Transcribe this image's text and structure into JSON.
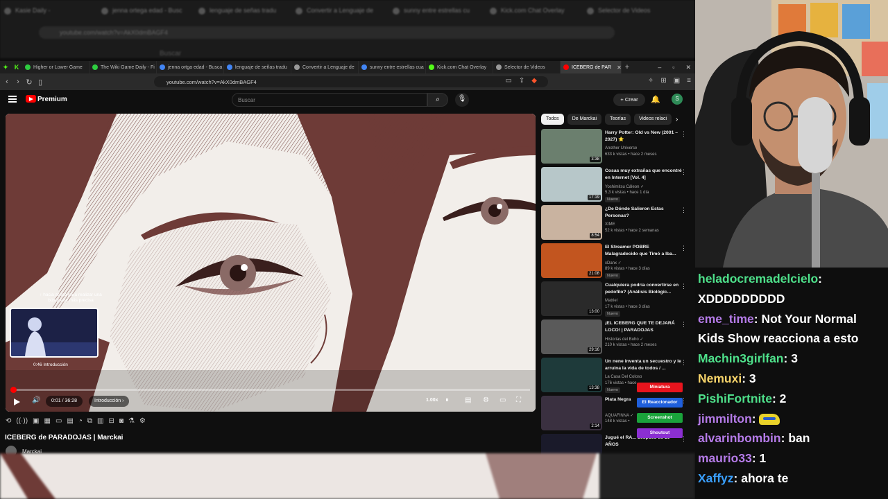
{
  "background": {
    "tabs": [
      "Kasie Daily -",
      "jenna ortega edad - Busc",
      "lenguaje de señas tradu",
      "Convertir a Lenguaje de",
      "sunny entre estrellas cu",
      "Kick.com Chat Overlay",
      "Selector de Videos",
      "ICEBERG de PA"
    ],
    "address": "youtube.com/watch?v=AkX0dmBAGF4",
    "search_hint": "Buscar"
  },
  "browser": {
    "tabs": [
      {
        "label": "Higher or Lower Game",
        "color": "#2ecc40",
        "active": false
      },
      {
        "label": "The Wiki Game Daily - Fi",
        "color": "#2ecc40",
        "active": false
      },
      {
        "label": "jenna ortga edad - Busca",
        "color": "#4285f4",
        "active": false
      },
      {
        "label": "lenguaje de señas tradu",
        "color": "#4285f4",
        "active": false
      },
      {
        "label": "Convertir a Lenguaje de",
        "color": "#999999",
        "active": false
      },
      {
        "label": "sunny entre estrellas cua",
        "color": "#4285f4",
        "active": false
      },
      {
        "label": "Kick.com Chat Overlay",
        "color": "#53fc18",
        "active": false
      },
      {
        "label": "Selector de Videos",
        "color": "#999999",
        "active": false
      },
      {
        "label": "ICEBERG de PAR",
        "color": "#ff0000",
        "active": true
      }
    ],
    "url": "youtube.com/watch?v=AkX0dmBAGF4"
  },
  "youtube": {
    "brand": "Premium",
    "search_placeholder": "Buscar",
    "create_label": "+ Crear",
    "avatar_letter": "S"
  },
  "player": {
    "preview_hint": "↑ hacia arriba para realizar una búsqueda más precisa",
    "preview_time": "0:46  Introducción",
    "current_time": "0:01 / 36:28",
    "chapter": "Introducción ›",
    "speed": "1.00x",
    "progress_fraction": 0.0005
  },
  "video": {
    "title": "ICEBERG de PARADOJAS | Marckai",
    "channel": "Marckai"
  },
  "sidebar": {
    "chips": [
      {
        "label": "Todos",
        "active": true
      },
      {
        "label": "De Marckai",
        "active": false
      },
      {
        "label": "Teorías",
        "active": false
      },
      {
        "label": "Videos relaci",
        "active": false
      }
    ],
    "recs": [
      {
        "title": "Harry Potter: Old vs New (2001 – 2027) ⭐",
        "channel": "Another Universe",
        "meta": "633 k vistas • hace 2 meses",
        "duration": "3:38",
        "badge": "",
        "thumb": "#6b7f6e"
      },
      {
        "title": "Cosas muy extrañas que encontré en Internet [Vol. 4]",
        "channel": "Yoshimitsu Cáleon ✓",
        "meta": "5,3 k vistas • hace 1 día",
        "duration": "17:19",
        "badge": "Nuevo",
        "thumb": "#b7c7c9"
      },
      {
        "title": "¿De Dónde Salieron Estas Personas?",
        "channel": "XIME",
        "meta": "52 k vistas • hace 2 semanas",
        "duration": "8:54",
        "badge": "",
        "thumb": "#c9b3a0"
      },
      {
        "title": "El Streamer POBRE Malagradecido que Timó a Iba...",
        "channel": "xDanx ✓",
        "meta": "89 k vistas • hace 3 días",
        "duration": "21:08",
        "badge": "Nuevo",
        "thumb": "#c2551f"
      },
      {
        "title": "Cualquiera podría convertirse en pedofilo? (Análisis Biológic...",
        "channel": "Matriel",
        "meta": "17 k vistas • hace 3 días",
        "duration": "13:00",
        "badge": "Nuevo",
        "thumb": "#2a2a2a"
      },
      {
        "title": "¡EL ICEBERG QUE TE DEJARÁ LOCO! | PARADOJAS",
        "channel": "Historias del Buho ✓",
        "meta": "210 k vistas • hace 2 meses",
        "duration": "29:16",
        "badge": "",
        "thumb": "#5a5a5a"
      },
      {
        "title": "Un nene inventa un secuestro y le arruina la vida de todos / ...",
        "channel": "La Casa Del Coloso",
        "meta": "176 vistas • hace",
        "duration": "13:38",
        "badge": "Nuevo",
        "thumb": "#1e3a3a"
      },
      {
        "title": "Plata Negra",
        "channel": "AQUAFINNA ✓",
        "meta": "148 k vistas •",
        "duration": "2:14",
        "badge": "",
        "thumb": "#3a3040"
      },
      {
        "title": "Jugué el RA... después de 20 AÑOS",
        "channel": "",
        "meta": "",
        "duration": "",
        "badge": "",
        "thumb": "#1a1a2a"
      }
    ]
  },
  "overlay_buttons": [
    {
      "label": "Miniatura",
      "color": "#e8141d"
    },
    {
      "label": "El Reaccionador",
      "color": "#1f5fdc"
    },
    {
      "label": "Screenshot",
      "color": "#1aa33b"
    },
    {
      "label": "Shoutout",
      "color": "#8b2fd1"
    }
  ],
  "chat": {
    "messages": [
      {
        "user": "heladocremadelcielo",
        "color": "#4ee08a",
        "text": "XDDDDDDDDD"
      },
      {
        "user": "eme_time",
        "color": "#b57be8",
        "text": "Not Your Normal Kids Show reacciona a esto"
      },
      {
        "user": "Machin3girlfan",
        "color": "#4ee08a",
        "text": "3"
      },
      {
        "user": "Nemuxi",
        "color": "#f7d46a",
        "text": "3"
      },
      {
        "user": "PishiFortnite",
        "color": "#4ee08a",
        "text": "2"
      },
      {
        "user": "jimmilton",
        "color": "#b57be8",
        "text": ""
      },
      {
        "user": "alvarinbombin",
        "color": "#b57be8",
        "text": "ban"
      },
      {
        "user": "maurio33",
        "color": "#b57be8",
        "text": "1"
      },
      {
        "user": "Xaffyz",
        "color": "#3aa0ff",
        "text": "ahora te"
      }
    ]
  }
}
